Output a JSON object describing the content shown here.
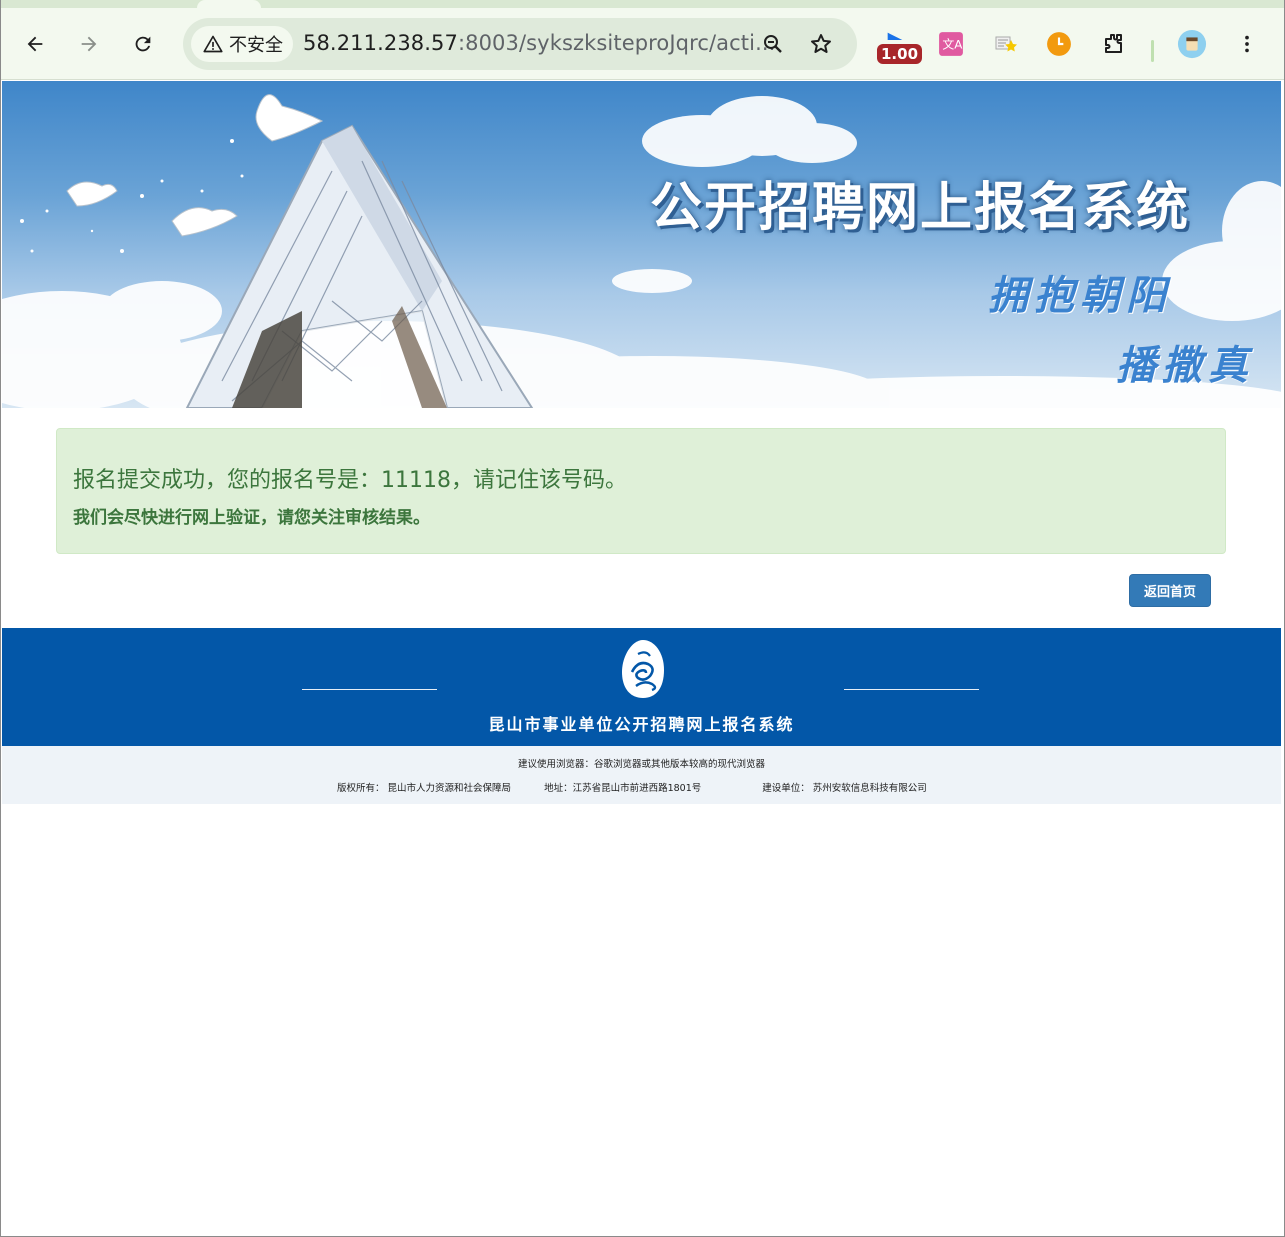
{
  "browser": {
    "security_label": "不安全",
    "url_host": "58.211.238.57",
    "url_rest": ":8003/sykszksiteproJqrc/acti...",
    "extension_badge": "1.00",
    "icons": [
      "back-arrow-icon",
      "forward-arrow-icon",
      "reload-icon",
      "warning-icon",
      "zoom-icon",
      "bookmark-star-icon",
      "speed-extension-icon",
      "translate-extension-icon",
      "notes-extension-icon",
      "timer-extension-icon",
      "extensions-puzzle-icon",
      "profile-avatar-icon",
      "more-menu-icon"
    ]
  },
  "banner": {
    "title": "公开招聘网上报名系统",
    "slogan_line1": "拥抱朝阳",
    "slogan_line2": "播撒真"
  },
  "alert": {
    "main_text": "报名提交成功，您的报名号是：11118，请记住该号码。",
    "sub_text": "我们会尽快进行网上验证，请您关注审核结果。",
    "color": "#3c763d",
    "background": "#dff0d8"
  },
  "actions": {
    "home_button": "返回首页"
  },
  "footer": {
    "title": "昆山市事业单位公开招聘网上报名系统",
    "browser_hint": "建议使用浏览器：谷歌浏览器或其他版本较高的现代浏览器",
    "copyright": "版权所有：  昆山市人力资源和社会保障局",
    "address": "地址：江苏省昆山市前进西路1801号",
    "builder": "建设单位：  苏州安软信息科技有限公司",
    "band_color": "#0357a8"
  }
}
